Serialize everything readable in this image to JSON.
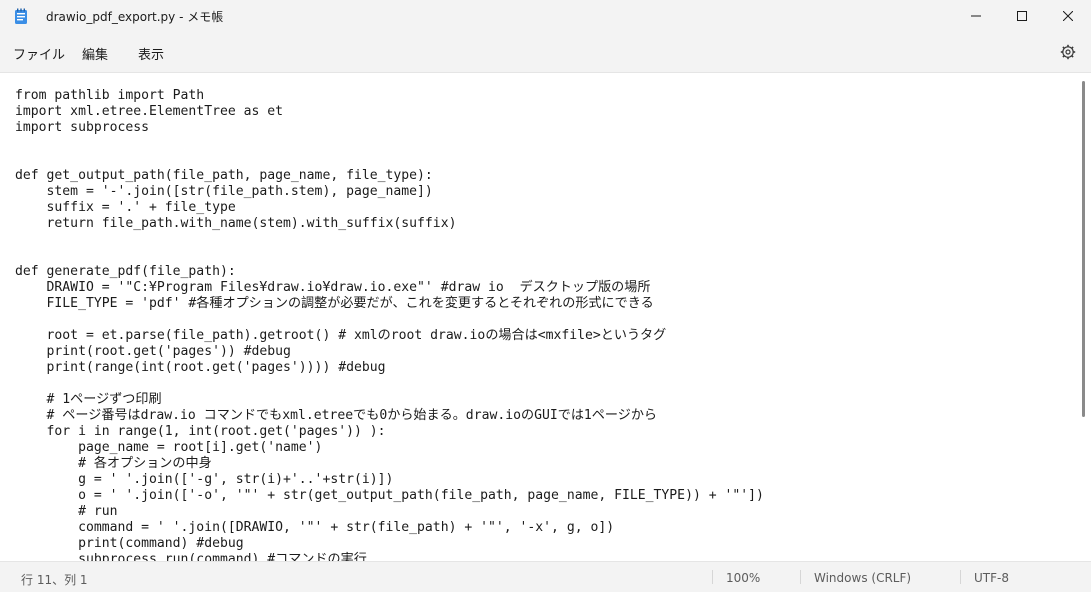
{
  "window": {
    "title": "drawio_pdf_export.py - メモ帳",
    "app_icon": "notepad-icon"
  },
  "menu": {
    "items": [
      "ファイル",
      "編集",
      "表示"
    ],
    "settings_icon": "gear-icon"
  },
  "editor": {
    "lines": [
      "from pathlib import Path",
      "import xml.etree.ElementTree as et",
      "import subprocess",
      "",
      "",
      "def get_output_path(file_path, page_name, file_type):",
      "    stem = '-'.join([str(file_path.stem), page_name])",
      "    suffix = '.' + file_type",
      "    return file_path.with_name(stem).with_suffix(suffix)",
      "",
      "",
      "def generate_pdf(file_path):",
      "    DRAWIO = '\"C:¥Program Files¥draw.io¥draw.io.exe\"' #draw io  デスクトップ版の場所",
      "    FILE_TYPE = 'pdf' #各種オプションの調整が必要だが、これを変更するとそれぞれの形式にできる",
      "",
      "    root = et.parse(file_path).getroot() # xmlのroot draw.ioの場合は<mxfile>というタグ",
      "    print(root.get('pages')) #debug",
      "    print(range(int(root.get('pages')))) #debug",
      "",
      "    # 1ページずつ印刷",
      "    # ページ番号はdraw.io コマンドでもxml.etreeでも0から始まる。draw.ioのGUIでは1ページから",
      "    for i in range(1, int(root.get('pages')) ):",
      "        page_name = root[i].get('name')",
      "        # 各オプションの中身",
      "        g = ' '.join(['-g', str(i)+'..'+str(i)])",
      "        o = ' '.join(['-o', '\"' + str(get_output_path(file_path, page_name, FILE_TYPE)) + '\"'])",
      "        # run",
      "        command = ' '.join([DRAWIO, '\"' + str(file_path) + '\"', '-x', g, o])",
      "        print(command) #debug",
      "        subprocess.run(command) #コマンドの実行"
    ]
  },
  "status": {
    "position": "行 11、列 1",
    "zoom": "100%",
    "line_ending": "Windows (CRLF)",
    "encoding": "UTF-8"
  }
}
